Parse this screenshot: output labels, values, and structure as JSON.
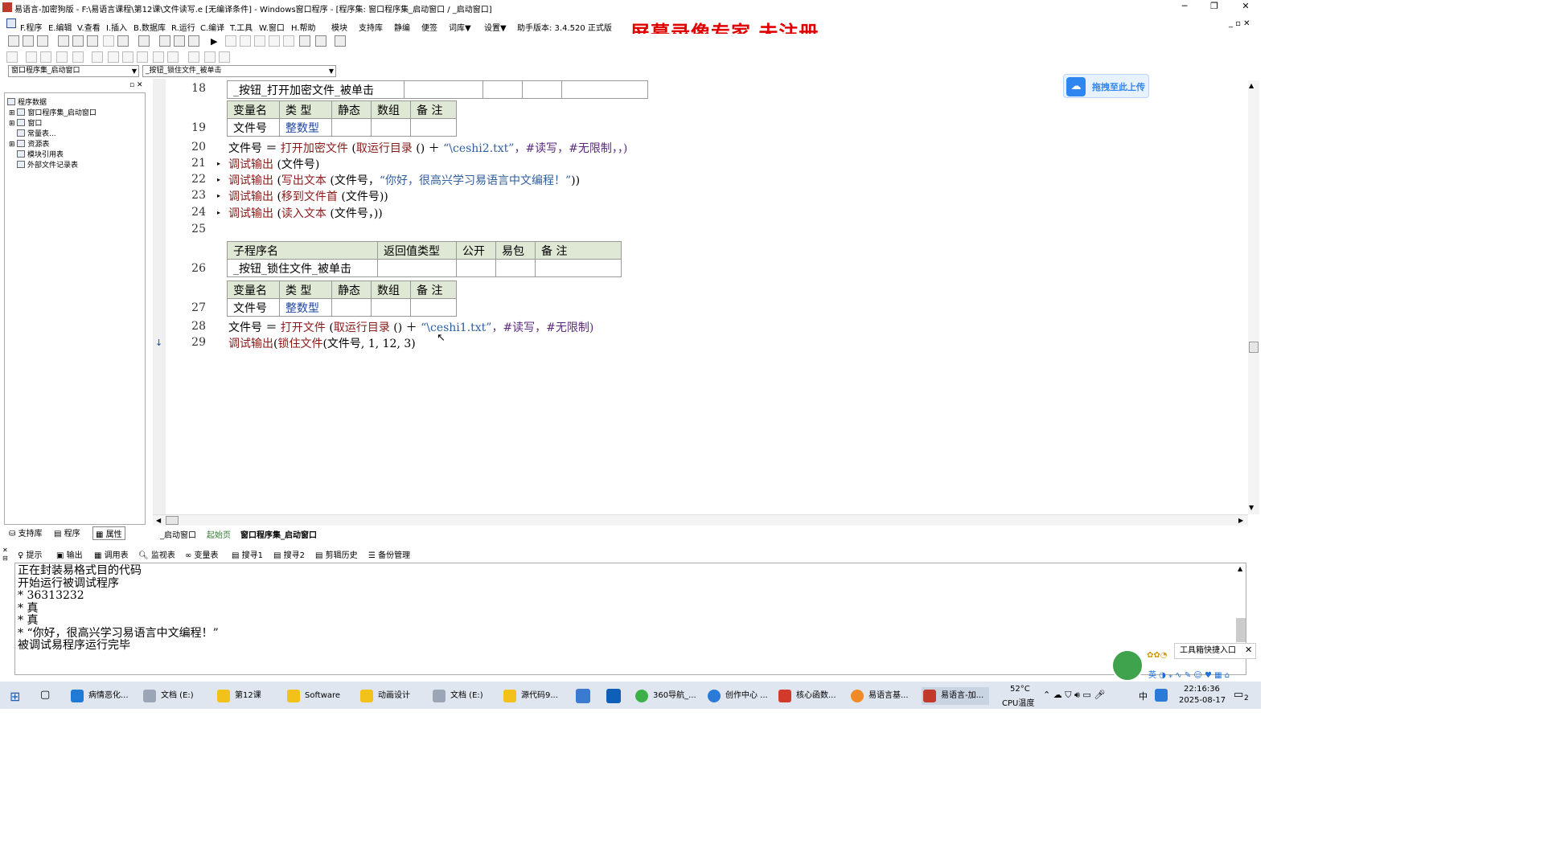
{
  "window": {
    "title": "易语言-加密狗版 - F:\\易语言课程\\第12课\\文件读写.e [无编译条件] - Windows窗口程序 - [程序集: 窗口程序集_启动窗口 / _启动窗口]",
    "watermark": "屏幕录像专家  未注册"
  },
  "menu": {
    "items": [
      "F.程序",
      "E.编辑",
      "V.查看",
      "I.插入",
      "B.数据库",
      "R.运行",
      "C.编译",
      "T.工具",
      "W.窗口",
      "H.帮助",
      "模块",
      "支持库",
      "静编",
      "便签",
      "词库▼",
      "设置▼"
    ],
    "version": "助手版本: 3.4.520 正式版"
  },
  "selectors": {
    "class_combo": "窗口程序集_启动窗口",
    "sub_combo": "_按钮_锁住文件_被单击"
  },
  "tree": {
    "root": "程序数据",
    "items": [
      "窗口程序集_启动窗口",
      "窗口",
      "常量表...",
      "资源表",
      "模块引用表",
      "外部文件记录表"
    ]
  },
  "left_tabs": [
    "支持库",
    "程序",
    "属性"
  ],
  "editor": {
    "line18": {
      "num": "18",
      "name": "_按钮_打开加密文件_被单击"
    },
    "var_header": [
      "变量名",
      "类 型",
      "静态",
      "数组",
      "备 注"
    ],
    "line19": {
      "num": "19",
      "var": "文件号",
      "type": "整数型"
    },
    "line20": {
      "num": "20",
      "a": "文件号 ＝ ",
      "b": "打开加密文件",
      "c": " (",
      "d": "取运行目录",
      "e": " () ＋ ",
      "f": "“\\ceshi2.txt”",
      "g": "，#读写，#无限制，，)"
    },
    "line21": {
      "num": "21",
      "a": "调试输出",
      "b": " (文件号)"
    },
    "line22": {
      "num": "22",
      "a": "调试输出",
      "b": " (",
      "c": "写出文本",
      "d": " (文件号，",
      "e": "“你好，很高兴学习易语言中文编程！”",
      "f": "))"
    },
    "line23": {
      "num": "23",
      "a": "调试输出",
      "b": " (",
      "c": "移到文件首",
      "d": " (文件号))"
    },
    "line24": {
      "num": "24",
      "a": "调试输出",
      "b": " (",
      "c": "读入文本",
      "d": " (文件号，))"
    },
    "line25": {
      "num": "25"
    },
    "sub_header": [
      "子程序名",
      "返回值类型",
      "公开",
      "易包",
      "备 注"
    ],
    "line26": {
      "num": "26",
      "name": "_按钮_锁住文件_被单击"
    },
    "line27": {
      "num": "27",
      "var": "文件号",
      "type": "整数型"
    },
    "line28": {
      "num": "28",
      "a": "文件号 ＝ ",
      "b": "打开文件",
      "c": " (",
      "d": "取运行目录",
      "e": " () ＋ ",
      "f": "“\\ceshi1.txt”",
      "g": "，#读写，#无限制)"
    },
    "line29": {
      "num": "29",
      "a": "调试输出",
      "b": "(",
      "c": "锁住文件",
      "d": "(文件号, 1, 12, 3)"
    }
  },
  "doc_tabs": [
    "_启动窗口",
    "起始页",
    "窗口程序集_启动窗口"
  ],
  "bottom_tabs": [
    "提示",
    "输出",
    "调用表",
    "监视表",
    "变量表",
    "搜寻1",
    "搜寻2",
    "剪辑历史",
    "备份管理"
  ],
  "output": [
    "正在封装易格式目的代码",
    "开始运行被调试程序",
    "* 36313232",
    "* 真",
    "* 真",
    "* “你好，很高兴学习易语言中文编程！”",
    "被调试易程序运行完毕"
  ],
  "upload": {
    "label": "拖拽至此上传"
  },
  "assist": {
    "label": "工具箱快捷入口"
  },
  "taskbar": {
    "items": [
      "病情恶化...",
      "文档 (E:)",
      "第12课",
      "Software",
      "动画设计",
      "文档 (E:)",
      "源代码9...",
      "360导航_...",
      "创作中心 ...",
      "核心函数...",
      "易语言基...",
      "易语言-加..."
    ],
    "temp": "52°C",
    "temp_label": "CPU温度",
    "ime": "中",
    "time": "22:16:36",
    "date": "2025-08-17",
    "notif": "2"
  }
}
